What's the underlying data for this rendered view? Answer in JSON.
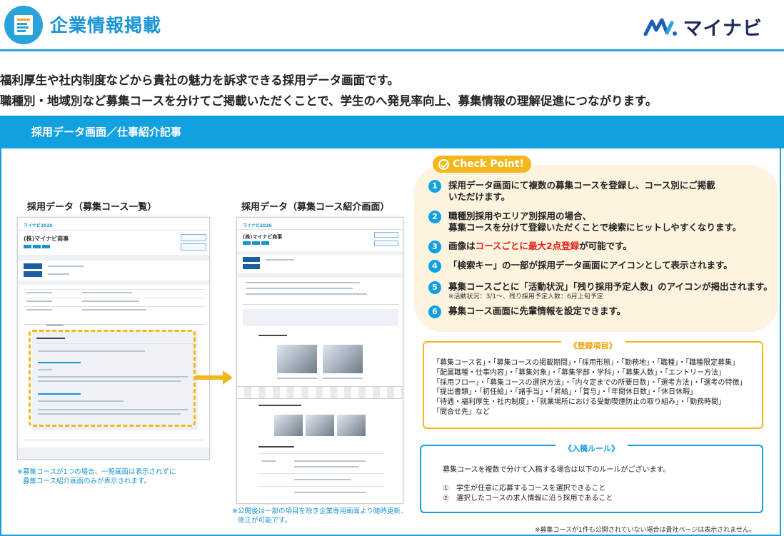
{
  "header": {
    "title": "企業情報掲載",
    "brand_name": "マイナビ"
  },
  "intro": {
    "line1": "福利厚生や社内制度などから貴社の魅力を訴求できる採用データ画面です。",
    "line2": "職種別・地域別など募集コースを分けてご掲載いただくことで、学生のへ発見率向上、募集情報の理解促進につながります。"
  },
  "section": {
    "title": "採用データ画面／仕事紹介記事"
  },
  "screens": {
    "left_caption": "採用データ（募集コース一覧）",
    "right_caption": "採用データ（募集コース紹介画面）",
    "company_name": "(株)マイナビ商事",
    "mini_logo": "マイナビ2026",
    "left_note_line1": "※募集コースが1つの場合、一覧画面は表示されずに",
    "left_note_line2": "募集コース紹介画面のみが表示されます。",
    "right_note_line1": "※公開後は一部の項目を除き企業専用画面より随時更新、",
    "right_note_line2": "修正が可能です。"
  },
  "checkpoint": {
    "badge": "Check Point!",
    "items": [
      {
        "num": "1",
        "line1": "採用データ画面にて複数の募集コースを登録し、コース別にご掲載",
        "line2": "いただけます。"
      },
      {
        "num": "2",
        "line1": "職種別採用やエリア別採用の場合、",
        "line2": "募集コースを分けて登録いただくことで検索にヒットしやすくなります。"
      },
      {
        "num": "3",
        "pre": "画像は",
        "red": "コースごとに最大2点登録",
        "post": "が可能です。"
      },
      {
        "num": "4",
        "line1": "「検索キー」の一部が採用データ画面にアイコンとして表示されます。"
      },
      {
        "num": "5",
        "line1": "募集コースごとに「活動状況」「残り採用予定人数」のアイコンが掲出されます。",
        "sub": "※活動状況：3/1～、残り採用予定人数：6月上旬予定"
      },
      {
        "num": "6",
        "line1": "募集コース画面に先輩情報を設定できます。"
      }
    ]
  },
  "registration": {
    "title": "《登録項目》",
    "lines": [
      "「募集コース名」・「募集コースの掲載期間」・「採用形態」・「勤務地」・「職種」・「職種限定募集」",
      "「配属職種・仕事内容」・「募集対象」・「募集学部・学科」・「募集人数」・「エントリー方法」",
      "「採用フロー」・「募集コースの選択方法」・「内々定までの所要日数」・「選考方法」・「選考の特徴」",
      "「提出書類」・「初任給」・「諸手当」・「昇給」・「賞与」・「年間休日数」・「休日休暇」",
      "「待遇・福利厚生・社内制度」・「就業場所における受動喫煙防止の取り組み」・「勤務時間」",
      "「問合せ先」など"
    ]
  },
  "rules": {
    "title": "《入稿ルール》",
    "lead": "募集コースを複数で分けて入稿する場合は以下のルールがございます。",
    "items": [
      "①　学生が任意に応募するコースを選択できること",
      "②　選択したコースの求人情報に沿う採用であること"
    ]
  },
  "footer_note": "※募集コースが1件も公開されていない場合は貴社ページは表示されません。",
  "colors": {
    "accent": "#12a1e0",
    "header_title": "#1a95d3",
    "checkpoint_bg": "#fdf3df",
    "highlight": "#f3b71b",
    "red": "#e2231a"
  }
}
